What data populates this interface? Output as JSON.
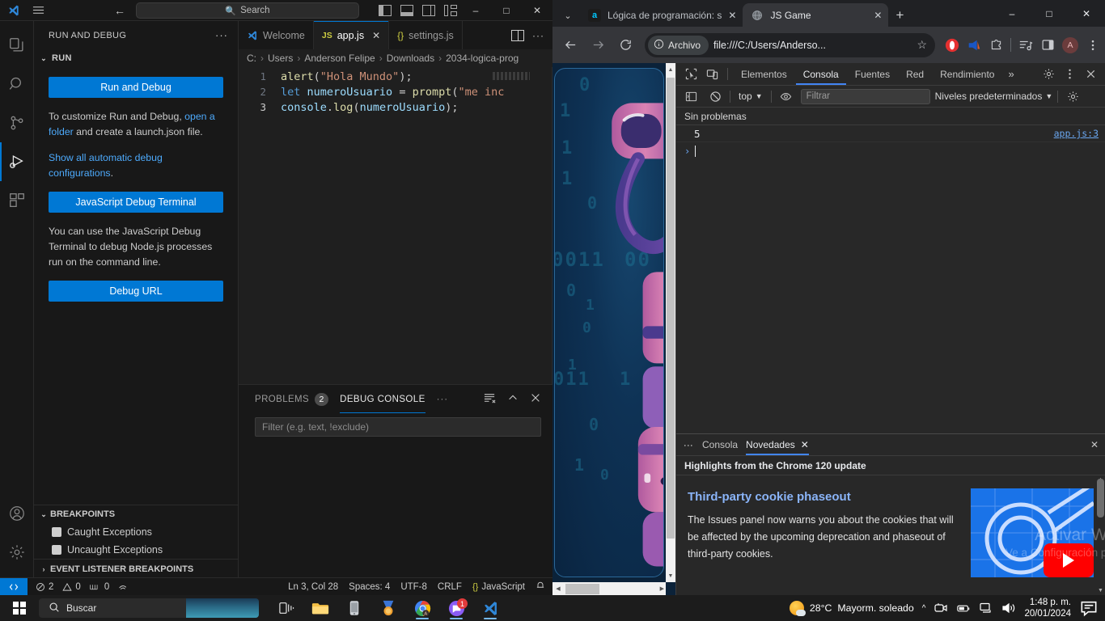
{
  "vscode": {
    "titlebar": {
      "search_placeholder": "Search",
      "search_icon": "search-icon",
      "menu_icon": "hamburger-menu-icon",
      "back_icon": "back-arrow-icon",
      "forward_icon": "forward-arrow-icon",
      "minimize": "–",
      "maximize": "□",
      "close": "✕"
    },
    "sidebar": {
      "title": "RUN AND DEBUG",
      "more_actions": "···",
      "section_run": "RUN",
      "run_and_debug_button": "Run and Debug",
      "customize_text_1": "To customize Run and Debug, ",
      "customize_link_1": "open a folder",
      "customize_text_2": " and create a launch.json file.",
      "show_all_link": "Show all automatic debug configurations",
      "show_all_period": ".",
      "js_debug_terminal_button": "JavaScript Debug Terminal",
      "js_debug_desc": "You can use the JavaScript Debug Terminal to debug Node.js processes run on the command line.",
      "debug_url_button": "Debug URL",
      "breakpoints_title": "BREAKPOINTS",
      "caught_exceptions": "Caught Exceptions",
      "uncaught_exceptions": "Uncaught Exceptions",
      "event_listener_breakpoints": "EVENT LISTENER BREAKPOINTS"
    },
    "tabs": [
      {
        "label": "Welcome",
        "icon": "vscode-logo-icon",
        "active": false,
        "closable": false
      },
      {
        "label": "app.js",
        "icon": "js-file-icon",
        "active": true,
        "closable": true
      },
      {
        "label": "settings.js",
        "icon": "json-file-icon",
        "active": false,
        "closable": false
      }
    ],
    "breadcrumb": [
      "C:",
      "Users",
      "Anderson Felipe",
      "Downloads",
      "2034-logica-prog"
    ],
    "code_lines": [
      {
        "num": "1",
        "tokens": [
          {
            "t": "alert",
            "c": "fn"
          },
          {
            "t": "(",
            "c": "pl"
          },
          {
            "t": "\"Hola Mundo\"",
            "c": "str"
          },
          {
            "t": ")",
            "c": "pl"
          },
          {
            "t": ";",
            "c": "pl"
          }
        ]
      },
      {
        "num": "2",
        "tokens": [
          {
            "t": "let ",
            "c": "kw"
          },
          {
            "t": "numeroUsuario",
            "c": "var"
          },
          {
            "t": " = ",
            "c": "op"
          },
          {
            "t": "prompt",
            "c": "fn"
          },
          {
            "t": "(",
            "c": "pl"
          },
          {
            "t": "\"me inc",
            "c": "str"
          }
        ]
      },
      {
        "num": "3",
        "tokens": [
          {
            "t": "console",
            "c": "var"
          },
          {
            "t": ".",
            "c": "pl"
          },
          {
            "t": "log",
            "c": "fn"
          },
          {
            "t": "(",
            "c": "pl"
          },
          {
            "t": "numeroUsuario",
            "c": "var"
          },
          {
            "t": ")",
            "c": "pl"
          },
          {
            "t": ";",
            "c": "pl"
          }
        ]
      }
    ],
    "panel": {
      "tab_problems": "PROBLEMS",
      "problems_count": "2",
      "tab_debug_console": "DEBUG CONSOLE",
      "more": "···",
      "clear_icon": "clear-console-icon",
      "maximize_icon": "chevron-up-icon",
      "close_icon": "close-icon",
      "filter_placeholder": "Filter (e.g. text, !exclude)"
    },
    "statusbar": {
      "remote_icon": "remote-window-icon",
      "errors": "2",
      "warnings": "0",
      "ports": "0",
      "radio_icon": "live-share-icon",
      "position": "Ln 3, Col 28",
      "spaces": "Spaces: 4",
      "encoding": "UTF-8",
      "eol": "CRLF",
      "language": "JavaScript",
      "bell_icon": "notifications-bell-icon"
    }
  },
  "chrome": {
    "tabs": [
      {
        "label": "Lógica de programación: s",
        "favicon": "alura-a-icon",
        "active": false
      },
      {
        "label": "JS Game",
        "favicon": "globe-icon",
        "active": true
      }
    ],
    "new_tab": "+",
    "tab_search_icon": "chevron-down-icon",
    "window_minimize": "–",
    "window_maximize": "□",
    "window_close": "✕",
    "toolbar": {
      "back_icon": "back-arrow-icon",
      "forward_icon": "forward-arrow-icon",
      "reload_icon": "reload-icon",
      "chip_icon": "info-circle-icon",
      "chip_label": "Archivo",
      "url": "file:///C:/Users/Anderso...",
      "star_icon": "bookmark-star-icon",
      "extensions": [
        "opera-gx-icon",
        "adblock-icon",
        "extensions-puzzle-icon",
        "media-list-icon",
        "side-panel-icon"
      ],
      "profile_letter": "A",
      "menu_icon": "three-dot-menu-icon"
    },
    "devtools": {
      "inspect_icon": "inspect-element-icon",
      "device_icon": "device-toolbar-icon",
      "tabs": [
        "Elementos",
        "Consola",
        "Fuentes",
        "Red",
        "Rendimiento"
      ],
      "active_tab": "Consola",
      "overflow": "»",
      "settings_icon": "gear-icon",
      "more_icon": "three-dot-menu-icon",
      "close_icon": "close-icon",
      "sidebar_icon": "console-sidebar-icon",
      "clear_icon": "clear-console-icon",
      "context": "top",
      "eye_icon": "live-expression-eye-icon",
      "filter_placeholder": "Filtrar",
      "levels": "Niveles predeterminados",
      "settings2_icon": "gear-icon",
      "issues_text": "Sin problemas",
      "log_entries": [
        {
          "value": "5",
          "source": "app.js:3"
        }
      ],
      "prompt_arrow": "›"
    },
    "whats_new": {
      "menu_icon": "three-dot-menu-icon",
      "tabs": [
        "Consola",
        "Novedades"
      ],
      "active_tab": "Novedades",
      "tab_close": "✕",
      "panel_close": "✕",
      "subtitle": "Highlights from the Chrome 120 update",
      "article_title": "Third-party cookie phaseout",
      "article_body": "The Issues panel now warns you about the cookies that will be affected by the upcoming deprecation and phaseout of third-party cookies.",
      "video_thumb": "chrome-cookie-video-thumbnail",
      "play_icon": "youtube-play-icon"
    },
    "page": {
      "title": "JS Game",
      "background_digits": [
        "0",
        "1",
        "1",
        "1",
        "0",
        "1",
        "0011",
        "00",
        "0",
        "1",
        "0",
        "1",
        "1",
        "011",
        "1",
        "0",
        "0",
        "1"
      ],
      "robot_image": "pink-purple-robot-illustration"
    }
  },
  "watermark": {
    "line1": "Activar Windows",
    "line2": "Ve a Configuración para activar Windows."
  },
  "taskbar": {
    "start_icon": "windows-start-icon",
    "search_placeholder": "Buscar",
    "search_icon": "search-icon",
    "apps": [
      {
        "name": "task-view-icon",
        "open": false
      },
      {
        "name": "file-explorer-icon",
        "open": false
      },
      {
        "name": "phone-link-icon",
        "open": false
      },
      {
        "name": "store-medal-icon",
        "open": false
      },
      {
        "name": "google-chrome-icon",
        "open": true
      },
      {
        "name": "messaging-app-icon",
        "open": true,
        "badge": "1"
      },
      {
        "name": "vs-code-icon",
        "open": true
      }
    ],
    "tray": {
      "weather_temp": "28°C",
      "weather_desc": "Mayorm. soleado",
      "weather_icon": "sun-cloud-icon",
      "chevron": "^",
      "icons": [
        "webcam-icon",
        "battery-icon",
        "network-icon",
        "volume-icon"
      ],
      "time": "1:48 p. m.",
      "date": "20/01/2024",
      "notification_icon": "notification-center-icon"
    }
  }
}
